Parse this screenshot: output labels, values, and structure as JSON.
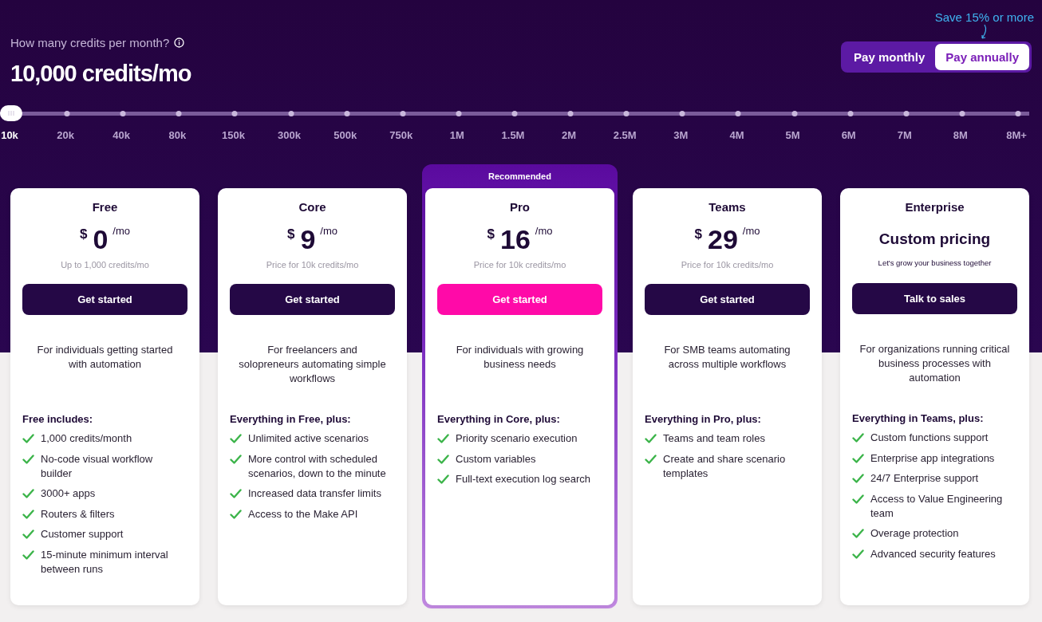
{
  "credits": {
    "question": "How many credits per month?",
    "amount": "10,000 credits/mo"
  },
  "billing": {
    "save_note": "Save 15% or more",
    "options": [
      {
        "label": "Pay monthly",
        "selected": false
      },
      {
        "label": "Pay annually",
        "selected": true
      }
    ]
  },
  "slider": {
    "level": 0,
    "ticks": [
      "10k",
      "20k",
      "40k",
      "80k",
      "150k",
      "300k",
      "500k",
      "750k",
      "1M",
      "1.5M",
      "2M",
      "2.5M",
      "3M",
      "4M",
      "5M",
      "6M",
      "7M",
      "8M",
      "8M+"
    ]
  },
  "plans": [
    {
      "name": "Free",
      "kind": "price",
      "recommended": false,
      "currency": "$",
      "amount": "0",
      "period": "/mo",
      "note": "Up to 1,000 credits/mo",
      "button": "Get started",
      "description": "For individuals getting started with automation",
      "features_heading": "Free includes:",
      "features": [
        "1,000 credits/month",
        "No-code visual workflow builder",
        "3000+ apps",
        "Routers & filters",
        "Customer support",
        "15-minute minimum interval between runs"
      ]
    },
    {
      "name": "Core",
      "kind": "price",
      "recommended": false,
      "currency": "$",
      "amount": "9",
      "period": "/mo",
      "note": "Price for 10k credits/mo",
      "button": "Get started",
      "description": "For freelancers and solopreneurs automating simple workflows",
      "features_heading": "Everything in Free, plus:",
      "features": [
        "Unlimited active scenarios",
        "More control with scheduled scenarios, down to the minute",
        "Increased data transfer limits",
        "Access to the Make API"
      ]
    },
    {
      "name": "Pro",
      "kind": "price",
      "recommended": true,
      "badge": "Recommended",
      "currency": "$",
      "amount": "16",
      "period": "/mo",
      "note": "Price for 10k credits/mo",
      "button": "Get started",
      "description": "For individuals with growing business needs",
      "features_heading": "Everything in Core, plus:",
      "features": [
        "Priority scenario execution",
        "Custom variables",
        "Full-text execution log search"
      ]
    },
    {
      "name": "Teams",
      "kind": "price",
      "recommended": false,
      "currency": "$",
      "amount": "29",
      "period": "/mo",
      "note": "Price for 10k credits/mo",
      "button": "Get started",
      "description": "For SMB teams automating across multiple workflows",
      "features_heading": "Everything in Pro, plus:",
      "features": [
        "Teams and team roles",
        "Create and share scenario templates"
      ]
    },
    {
      "name": "Enterprise",
      "kind": "custom",
      "recommended": false,
      "custom_price": "Custom pricing",
      "note": "Let's grow your business together",
      "button": "Talk to sales",
      "description": "For organizations running critical business processes with automation",
      "features_heading": "Everything in Teams, plus:",
      "features": [
        "Custom functions support",
        "Enterprise app integrations",
        "24/7 Enterprise support",
        "Access to Value Engineering team",
        "Overage protection",
        "Advanced security features"
      ]
    }
  ]
}
